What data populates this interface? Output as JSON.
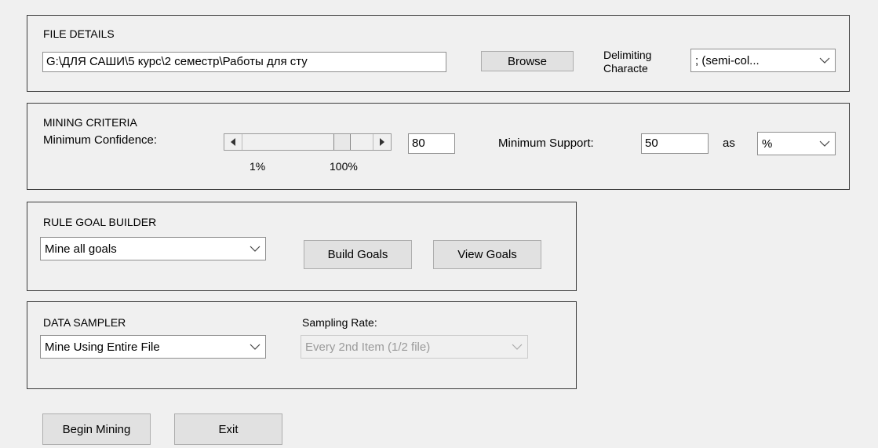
{
  "file_details": {
    "title": "FILE DETAILS",
    "path_value": "G:\\ДЛЯ САШИ\\5 курс\\2 семестр\\Работы для сту",
    "browse_label": "Browse",
    "delimiting_label_line1": "Delimiting",
    "delimiting_label_line2": "Characte",
    "delimiter_selected": "; (semi-col..."
  },
  "mining_criteria": {
    "title": "MINING CRITERIA",
    "min_confidence_label": "Minimum Confidence:",
    "slider_min_label": "1%",
    "slider_max_label": "100%",
    "slider_fraction": 0.8,
    "confidence_value": "80",
    "min_support_label": "Minimum Support:",
    "support_value": "50",
    "as_label": "as",
    "support_unit": "%"
  },
  "rule_goal_builder": {
    "title": "RULE GOAL BUILDER",
    "goal_selected": "Mine all goals",
    "build_goals_label": "Build Goals",
    "view_goals_label": "View Goals"
  },
  "data_sampler": {
    "title": "DATA SAMPLER",
    "sampler_selected": "Mine Using Entire File",
    "sampling_rate_label": "Sampling Rate:",
    "sampling_rate_selected": "Every 2nd Item (1/2 file)"
  },
  "footer": {
    "begin_label": "Begin Mining",
    "exit_label": "Exit"
  },
  "icons": {
    "dropdown": "chevron-down-icon",
    "slider_left": "triangle-left-icon",
    "slider_right": "triangle-right-icon"
  }
}
